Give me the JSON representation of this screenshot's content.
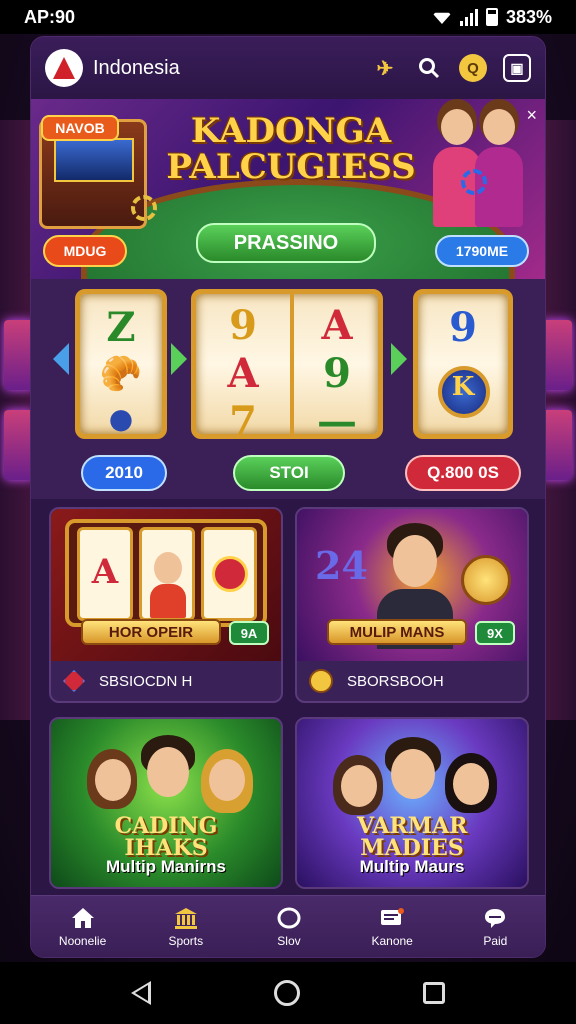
{
  "status": {
    "time": "AP:90",
    "battery": "383%"
  },
  "header": {
    "title": "Indonesia",
    "icons": [
      "ticket-icon",
      "search-icon",
      "coin-icon",
      "wallet-icon"
    ],
    "coin_symbol": "Q"
  },
  "banner": {
    "title_line1": "KADONGA",
    "title_line2": "PALCUGIESS",
    "tag": "NAVOB",
    "left_button": "MDUG",
    "center_button": "PRASSINO",
    "right_button": "1790ME",
    "close_symbol": "×"
  },
  "slots": {
    "reel1": [
      "Z",
      "🥐",
      "●"
    ],
    "reel2": [
      "9",
      "A",
      "7"
    ],
    "reel3": [
      "A",
      "9",
      "—"
    ],
    "reel4": [
      "9",
      "K"
    ],
    "left_button": "2010",
    "center_button": "STOI",
    "right_button": "Q.800 0S"
  },
  "cards": [
    {
      "label": "HOR OPEIR",
      "badge": "9A",
      "footer": "SBSIOCDN H",
      "reels": [
        "A",
        "♀",
        "Ø"
      ]
    },
    {
      "label": "MULIP MANS",
      "badge": "9X",
      "footer": "SBORSBOOH",
      "stamp": "24"
    },
    {
      "stamp_line1": "CADING",
      "stamp_line2": "IHAKS",
      "caption": "Multip Manirns"
    },
    {
      "stamp_line1": "VARMAR",
      "stamp_line2": "MADIES",
      "caption": "Multip Maurs"
    }
  ],
  "bottom_nav": [
    {
      "label": "Noonelie",
      "icon": "home-icon"
    },
    {
      "label": "Sports",
      "icon": "building-icon"
    },
    {
      "label": "Slov",
      "icon": "ring-icon"
    },
    {
      "label": "Kanone",
      "icon": "message-icon"
    },
    {
      "label": "Paid",
      "icon": "chat-icon"
    }
  ],
  "colors": {
    "accent": "#f3c640",
    "panel": "#2b1645",
    "green": "#2a8a2a",
    "blue": "#2a7ae8",
    "red": "#d02a3a"
  }
}
